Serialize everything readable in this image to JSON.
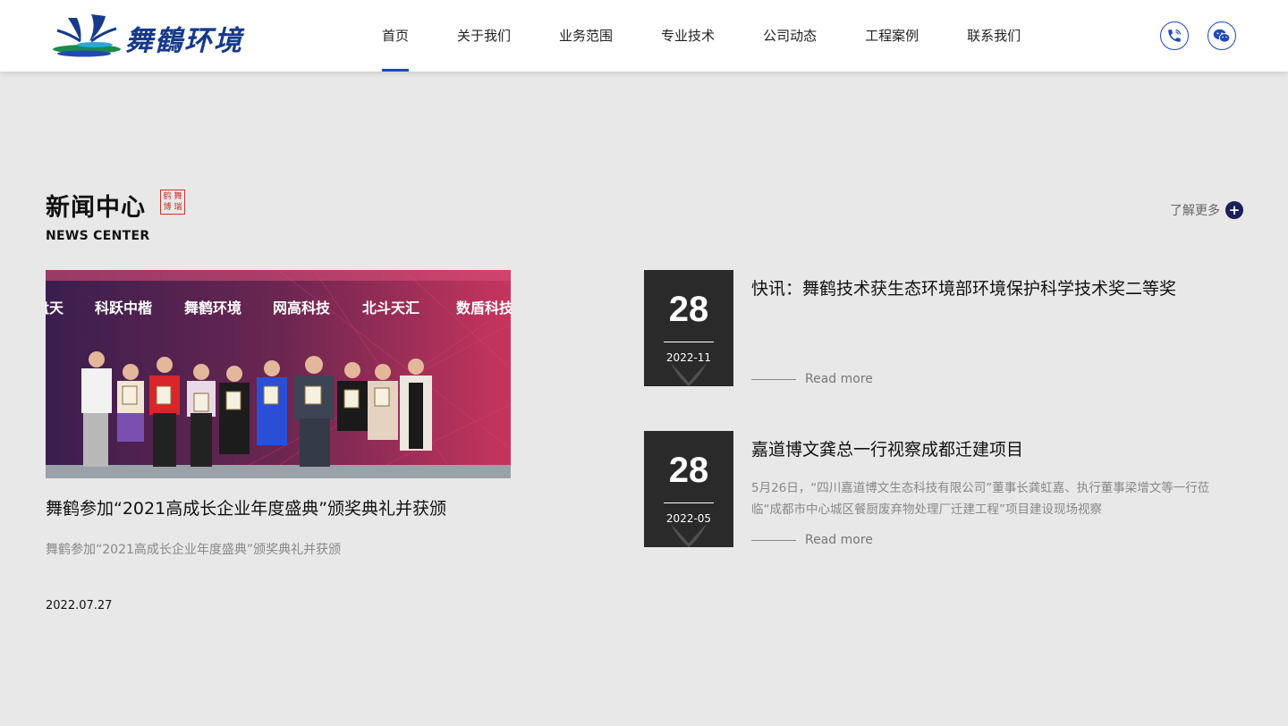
{
  "brand": {
    "logo_text": "舞鶴环境",
    "colors": {
      "primary": "#1f49b5",
      "dark": "#2a2a2a",
      "seal": "#c8352e",
      "more_icon": "#1b1f5a"
    }
  },
  "nav": [
    {
      "label": "首页",
      "active": true
    },
    {
      "label": "关于我们"
    },
    {
      "label": "业务范围"
    },
    {
      "label": "专业技术"
    },
    {
      "label": "公司动态"
    },
    {
      "label": "工程案例"
    },
    {
      "label": "联系我们"
    }
  ],
  "header_icons": [
    "phone-icon",
    "wechat-icon"
  ],
  "section": {
    "title": "新闻中心",
    "subtitle": "NEWS CENTER",
    "seal_chars": [
      "鹤",
      "舞",
      "博",
      "瑞"
    ],
    "more_label": "了解更多"
  },
  "featured": {
    "banner_words": [
      "盘天",
      "科跃中楷",
      "舞鹤环境",
      "网高科技",
      "北斗天汇",
      "数盾科技"
    ],
    "title": "舞鹤参加“2021高成长企业年度盛典”颁奖典礼并获颁",
    "desc": "舞鹤参加“2021高成长企业年度盛典”颁奖典礼并获颁",
    "date": "2022.07.27"
  },
  "news": [
    {
      "day": "28",
      "ym": "2022-11",
      "title": "快讯：舞鹤技术获生态环境部环境保护科学技术奖二等奖",
      "desc": "",
      "readmore": "Read more"
    },
    {
      "day": "28",
      "ym": "2022-05",
      "title": "嘉道博文龚总一行视察成都迁建项目",
      "desc": "5月26日，“四川嘉道博文生态科技有限公司”董事长龚虹嘉、执行董事梁增文等一行莅临“成都市中心城区餐厨废弃物处理厂迁建工程”项目建设现场视察",
      "readmore": "Read more"
    }
  ]
}
